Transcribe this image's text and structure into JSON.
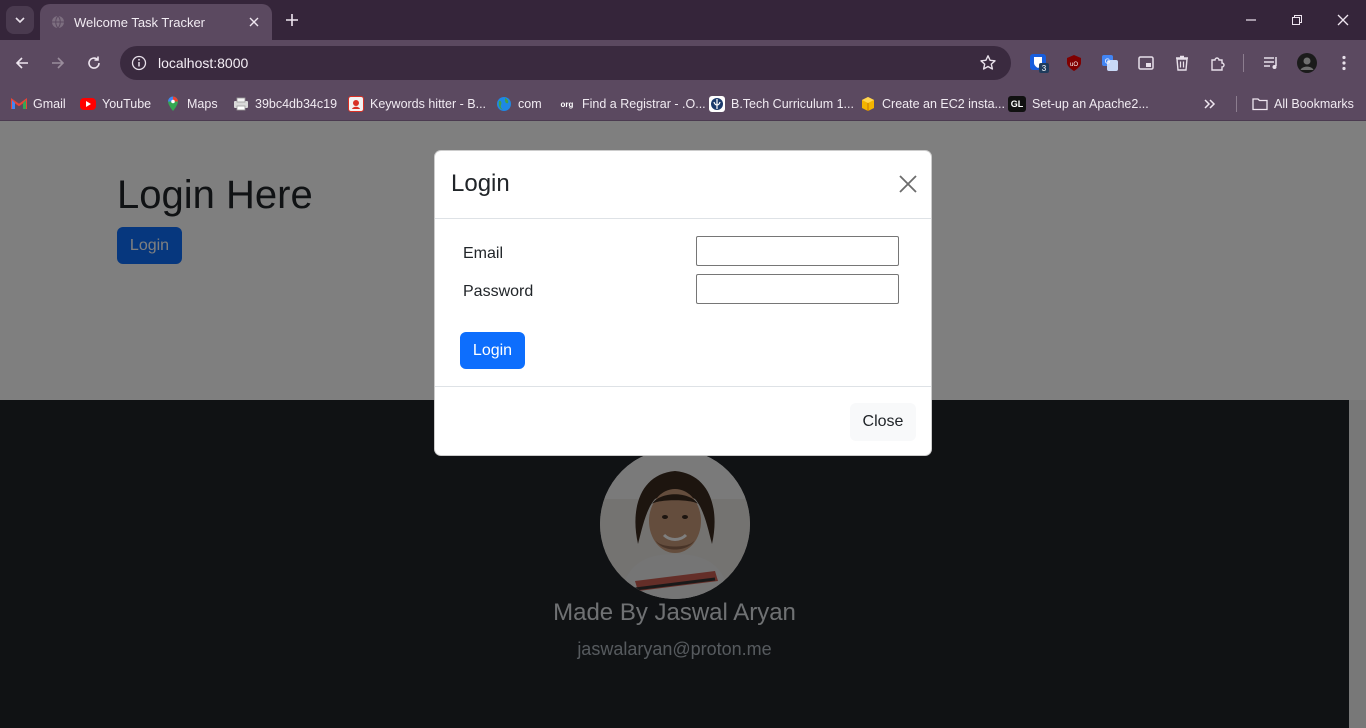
{
  "browser": {
    "tab": {
      "title": "Welcome Task Tracker"
    },
    "address_bar": {
      "url": "localhost:8000"
    },
    "bookmarks": [
      {
        "label": "Gmail",
        "icon": "gmail-icon",
        "color": "#ea4335"
      },
      {
        "label": "YouTube",
        "icon": "youtube-icon",
        "color": "#ff0000"
      },
      {
        "label": "Maps",
        "icon": "maps-icon",
        "color": "#34a853"
      },
      {
        "label": "39bc4db34c19",
        "icon": "printer-icon",
        "color": "#c9c9c9"
      },
      {
        "label": "Keywords hitter - B...",
        "icon": "keywords-icon",
        "color": "#d93025"
      },
      {
        "label": "com",
        "icon": "globe-icon",
        "color": "#2e7d32"
      },
      {
        "label": "Find a Registrar - .O...",
        "icon": "org-icon",
        "color": "#1a4fa3"
      },
      {
        "label": "B.Tech Curriculum 1...",
        "icon": "university-icon",
        "color": "#1b3a6b"
      },
      {
        "label": "Create an EC2 insta...",
        "icon": "aws-box-icon",
        "color": "#f4b400"
      },
      {
        "label": "Set-up an Apache2...",
        "icon": "gl-icon",
        "color": "#111111"
      }
    ],
    "all_bookmarks_label": "All Bookmarks",
    "profile_badge": "3"
  },
  "page": {
    "title": "Login Here",
    "login_button": "Login",
    "footer": {
      "name": "Made By Jaswal Aryan",
      "email": "jaswalaryan@proton.me"
    }
  },
  "modal": {
    "title": "Login",
    "email_label": "Email",
    "email_value": "",
    "password_label": "Password",
    "password_value": "",
    "submit_label": "Login",
    "close_label": "Close"
  },
  "colors": {
    "primary": "#0d6efd",
    "footer_bg": "#212529",
    "chrome_bg": "#35253a",
    "toolbar_bg": "#5b4960"
  }
}
